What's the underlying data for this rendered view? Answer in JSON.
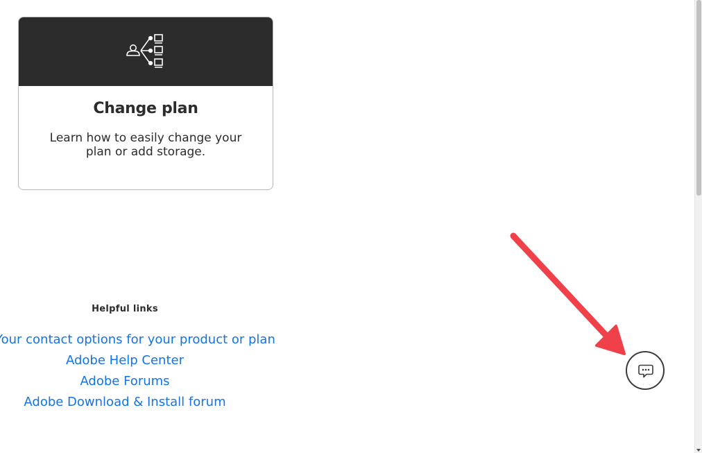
{
  "card": {
    "icon": "user-hierarchy-icon",
    "title": "Change plan",
    "description": "Learn how to easily change your plan or add storage.",
    "header_color": "#2c2c2c"
  },
  "helpful_links": {
    "heading": "Helpful links",
    "items": [
      {
        "label": "Your contact options for your product or plan"
      },
      {
        "label": "Adobe Help Center"
      },
      {
        "label": "Adobe Forums"
      },
      {
        "label": "Adobe Download & Install forum"
      }
    ],
    "link_color": "#1473e6"
  },
  "chat": {
    "icon": "chat-bubble-icon"
  },
  "annotation": {
    "type": "arrow",
    "color": "#f0414a",
    "points_to": "chat-button"
  }
}
